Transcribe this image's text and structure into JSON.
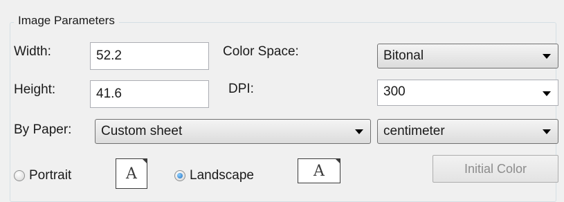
{
  "group": {
    "title": "Image Parameters"
  },
  "width": {
    "label": "Width:",
    "value": "52.2"
  },
  "height": {
    "label": "Height:",
    "value": "41.6"
  },
  "color_space": {
    "label": "Color Space:",
    "selected": "Bitonal"
  },
  "dpi": {
    "label": "DPI:",
    "selected": "300"
  },
  "paper": {
    "label": "By Paper:",
    "selected": "Custom sheet"
  },
  "unit": {
    "selected": "centimeter"
  },
  "orientation": {
    "portrait_label": "Portrait",
    "landscape_label": "Landscape",
    "selected": "Landscape",
    "page_glyph": "A"
  },
  "initial_color_button": {
    "label": "Initial Color"
  }
}
